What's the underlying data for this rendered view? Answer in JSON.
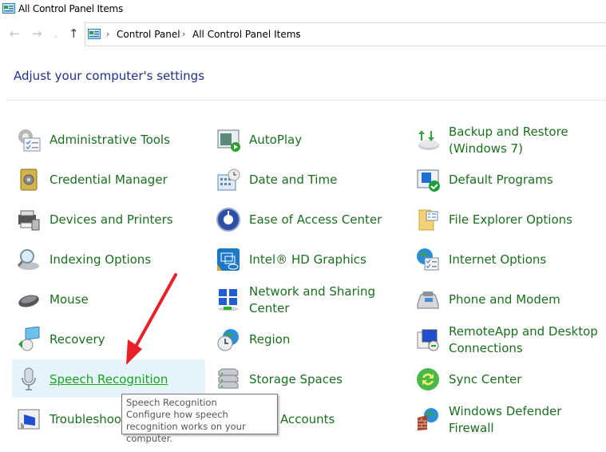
{
  "window": {
    "title": "All Control Panel Items"
  },
  "navigation": {
    "back_icon": "arrow-left-icon",
    "forward_icon": "arrow-right-icon",
    "recent_icon": "chevron-down-icon",
    "up_icon": "arrow-up-icon",
    "breadcrumb": [
      "Control Panel",
      "All Control Panel Items"
    ]
  },
  "heading": "Adjust your computer's settings",
  "items": [
    {
      "label": "Administrative Tools",
      "icon": "admin-tools-icon"
    },
    {
      "label": "AutoPlay",
      "icon": "autoplay-icon"
    },
    {
      "label": "Backup and Restore\n(Windows 7)",
      "icon": "backup-icon"
    },
    {
      "label": "Credential Manager",
      "icon": "safe-icon"
    },
    {
      "label": "Date and Time",
      "icon": "calendar-clock-icon"
    },
    {
      "label": "Default Programs",
      "icon": "default-programs-icon"
    },
    {
      "label": "Devices and Printers",
      "icon": "printer-icon"
    },
    {
      "label": "Ease of Access Center",
      "icon": "ease-of-access-icon"
    },
    {
      "label": "File Explorer Options",
      "icon": "folder-options-icon"
    },
    {
      "label": "Indexing Options",
      "icon": "indexing-icon"
    },
    {
      "label": "Intel® HD Graphics",
      "icon": "intel-graphics-icon"
    },
    {
      "label": "Internet Options",
      "icon": "globe-options-icon"
    },
    {
      "label": "Mouse",
      "icon": "mouse-icon"
    },
    {
      "label": "Network and Sharing\nCenter",
      "icon": "network-icon"
    },
    {
      "label": "Phone and Modem",
      "icon": "phone-icon"
    },
    {
      "label": "Recovery",
      "icon": "recovery-icon"
    },
    {
      "label": "Region",
      "icon": "globe-clock-icon"
    },
    {
      "label": "RemoteApp and Desktop\nConnections",
      "icon": "remote-desktop-icon"
    },
    {
      "label": "Speech Recognition",
      "icon": "microphone-icon"
    },
    {
      "label": "Storage Spaces",
      "icon": "storage-icon"
    },
    {
      "label": "Sync Center",
      "icon": "sync-icon"
    },
    {
      "label": "Troubleshooting",
      "icon": "troubleshoot-icon"
    },
    {
      "label": "User Accounts",
      "icon": "user-accounts-icon"
    },
    {
      "label": "Windows Defender\nFirewall",
      "icon": "firewall-icon"
    }
  ],
  "tooltip": {
    "title": "Speech Recognition",
    "body": "Configure how speech recognition works on your computer."
  },
  "colors": {
    "link": "#1a6f1e",
    "hover_bg": "#e5f3fb",
    "heading": "#1e3287",
    "arrow": "#e8202a"
  }
}
